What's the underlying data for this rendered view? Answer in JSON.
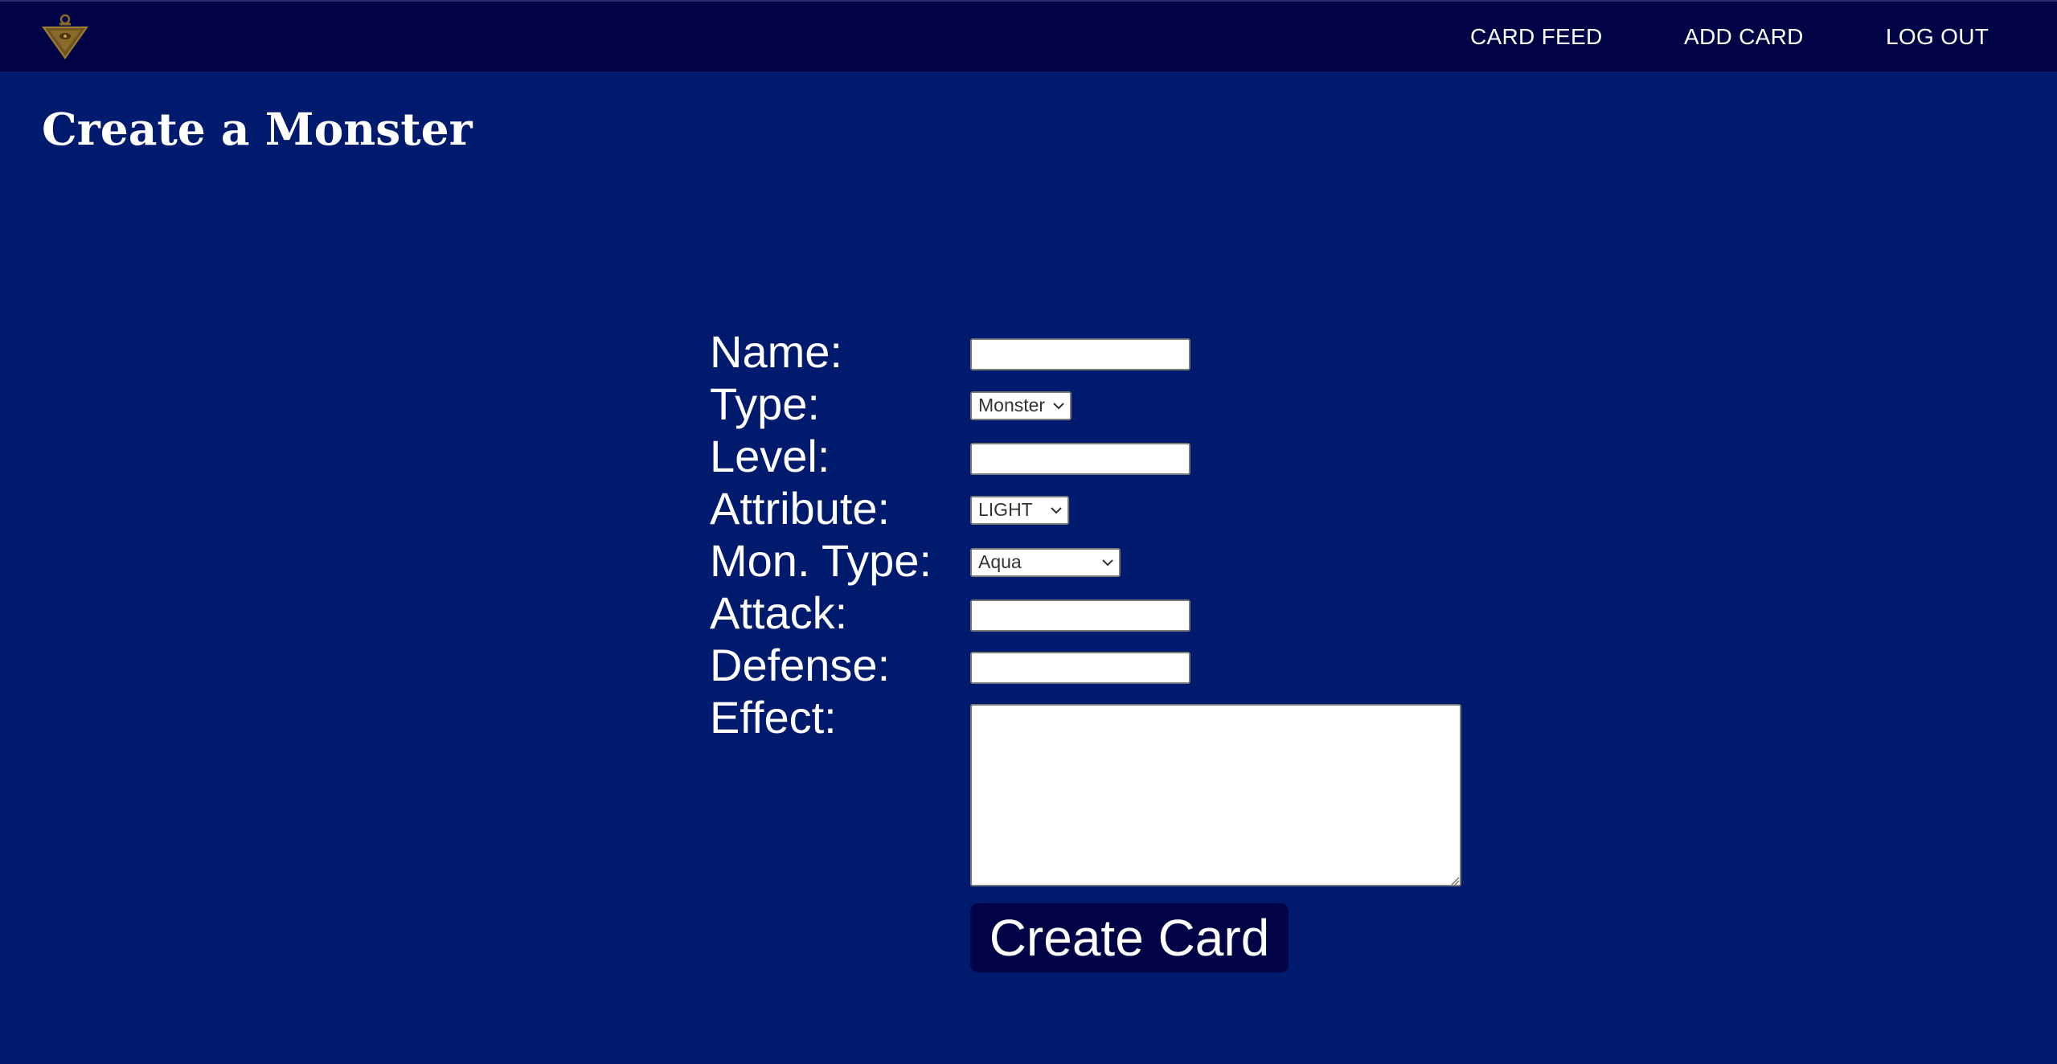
{
  "nav": {
    "logo_icon": "millennium-puzzle-icon",
    "links": [
      {
        "label": "CARD FEED"
      },
      {
        "label": "ADD CARD"
      },
      {
        "label": "LOG OUT"
      }
    ]
  },
  "page": {
    "title": "Create a Monster"
  },
  "form": {
    "name_label": "Name:",
    "name_value": "",
    "type_label": "Type:",
    "type_value": "Monster",
    "level_label": "Level:",
    "level_value": "",
    "attribute_label": "Attribute:",
    "attribute_value": "LIGHT",
    "mon_type_label": "Mon. Type:",
    "mon_type_value": "Aqua",
    "attack_label": "Attack:",
    "attack_value": "",
    "defense_label": "Defense:",
    "defense_value": "",
    "effect_label": "Effect:",
    "effect_value": "",
    "submit_label": "Create Card"
  },
  "colors": {
    "background": "#001a6e",
    "navbar": "#000447",
    "button": "#000447",
    "text": "#ffffff",
    "logo_gold": "#8a6a2a"
  }
}
